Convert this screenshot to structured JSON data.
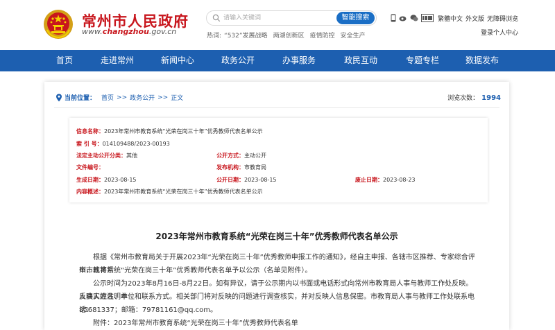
{
  "header": {
    "site_title": "常州市人民政府",
    "site_url_prefix": "www.",
    "site_url_brand": "changzhou",
    "site_url_suffix": ".gov.cn",
    "search": {
      "placeholder": "请输入关键词",
      "button_label": "智能搜索"
    },
    "hot": {
      "label": "热词:",
      "words": [
        "“532”发展战略",
        "两湖创新区",
        "疫情防控",
        "安全生产"
      ]
    },
    "tools": {
      "traditional": "繁體中文",
      "foreign": "外文版",
      "accessible": "无障碍浏览",
      "login": "登录个人中心"
    },
    "colors": {
      "brand_red": "#c8161d",
      "nav_blue": "#1d5fb0",
      "search_blue": "#1a6ec5"
    }
  },
  "nav": {
    "items": [
      "首页",
      "走进常州",
      "新闻中心",
      "政务公开",
      "办事服务",
      "政民互动",
      "专题专栏",
      "数据发布"
    ]
  },
  "breadcrumb": {
    "label": "当前位置：",
    "items": [
      "首页",
      "政务公开",
      "正文"
    ],
    "separator": ">>"
  },
  "views": {
    "label": "浏览次数：",
    "count": "1994"
  },
  "info": {
    "name_label": "信息名称：",
    "name_value": "2023年常州市教育系统“光荣在岗三十年”优秀教师代表名单公示",
    "index_label": "索 引 号：",
    "index_value": "014109488/2023-00193",
    "disclosure_mode_label": "法定主动公开分类：",
    "disclosure_mode_value": "其他",
    "open_mode_label": "公开方式：",
    "open_mode_value": "主动公开",
    "doc_no_label": "文件编号：",
    "doc_no_value": "",
    "publisher_label": "发布机构：",
    "publisher_value": "市教育局",
    "created_label": "生成日期：",
    "created_value": "2023-08-15",
    "published_label": "公开日期：",
    "published_value": "2023-08-15",
    "expiry_label": "废止日期：",
    "expiry_value": "2023-08-23",
    "summary_label": "内容概述：",
    "summary_value": "2023年常州市教育系统“光荣在岗三十年”优秀教师代表名单公示"
  },
  "article": {
    "title": "2023年常州市教育系统“光荣在岗三十年”优秀教师代表名单公示",
    "p1_line1": "根据《常州市教育局关于开展2023年“光荣在岗三十年”优秀教师申报工作的通知》，经自主申报、各辖市区推荐、专家综合评审，现将常",
    "p1_line2": "州市教育系统“光荣在岗三十年”优秀教师代表名单予以公示（名单见附件）。",
    "p2_line1": "公示时间为2023年8月16日-8月22日。如有异议，请于公示期内以书面或电话形式向常州市教育局人事与教师工作处反映。反映人应注明本",
    "p2_line2": "人真实姓名、单位和联系方式。相关部门将对反映的问题进行调查核实，并对反映人信息保密。市教育局人事与教师工作处联系电话：",
    "p2_line3": "85681337；邮箱：79781161@qq.com。",
    "p3": "附件：2023年常州市教育系统“光荣在岗三十年”优秀教师代表名单"
  }
}
